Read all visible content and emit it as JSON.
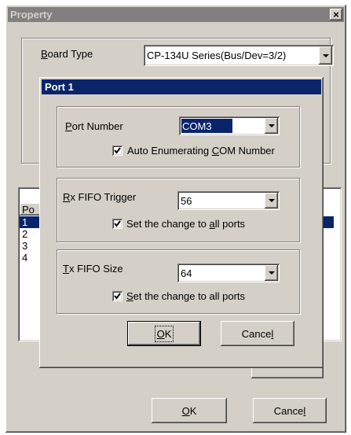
{
  "property": {
    "title": "Property",
    "close_glyph": "×",
    "board_type_label_accel": "B",
    "board_type_label_rest": "oard Type",
    "board_type_value": "CP-134U Series(Bus/Dev=3/2)",
    "port_list_header": "Po",
    "ports": [
      "1",
      "2",
      "3",
      "4"
    ],
    "ok_accel": "O",
    "ok_rest": "K",
    "cancel_pre": "Cance",
    "cancel_accel": "l"
  },
  "port_dialog": {
    "title": "Port 1",
    "port_number_label_accel": "P",
    "port_number_label_rest": "ort Number",
    "port_number_value": "COM3",
    "auto_enum_pre": "Auto Enumerating ",
    "auto_enum_accel": "C",
    "auto_enum_rest": "OM Number",
    "auto_enum_checked": true,
    "rx_label_accel": "R",
    "rx_label_rest": "x FIFO Trigger",
    "rx_value": "56",
    "rx_apply_pre": "Set the change to ",
    "rx_apply_accel": "a",
    "rx_apply_rest": "ll ports",
    "rx_apply_checked": true,
    "tx_label_accel": "T",
    "tx_label_rest": "x FIFO Size",
    "tx_value": "64",
    "tx_apply_accel": "S",
    "tx_apply_rest": "et the change to all ports",
    "tx_apply_checked": true,
    "ok_accel": "O",
    "ok_rest": "K",
    "cancel_pre": "Cance",
    "cancel_accel": "l"
  }
}
